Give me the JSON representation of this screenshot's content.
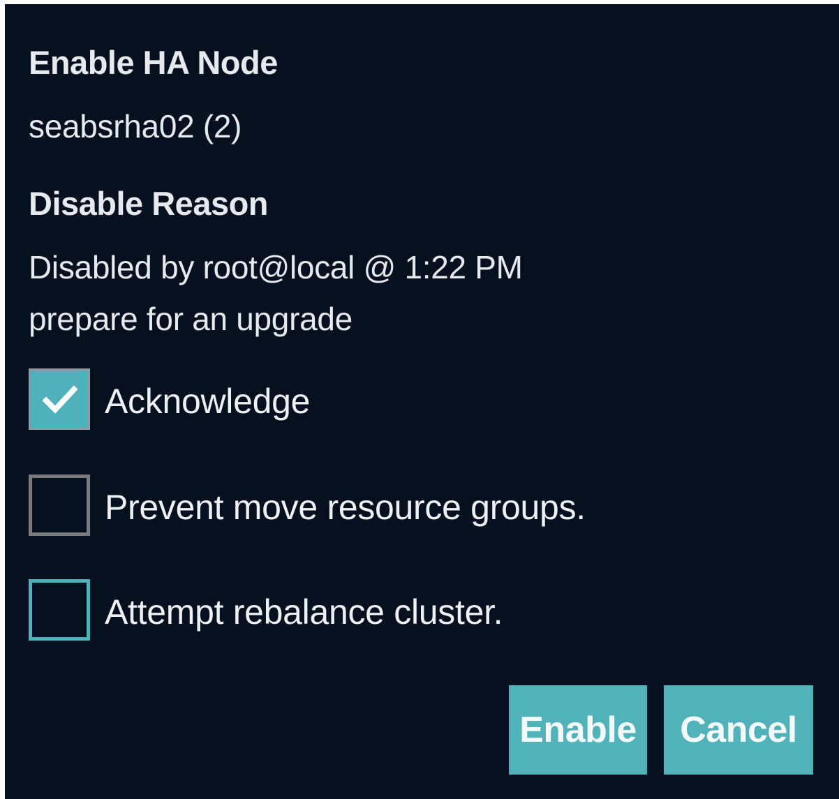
{
  "dialog": {
    "title": "Enable HA Node",
    "node_name": "seabsrha02 (2)",
    "reason_heading": "Disable Reason",
    "reason_line1": "Disabled by  root@local @ 1:22 PM",
    "reason_line2": "prepare for an upgrade"
  },
  "options": {
    "acknowledge": {
      "label": "Acknowledge",
      "checked": true
    },
    "prevent_move": {
      "label": "Prevent move resource groups.",
      "checked": false
    },
    "rebalance": {
      "label": "Attempt rebalance cluster.",
      "checked": false
    }
  },
  "buttons": {
    "enable_label": "Enable",
    "cancel_label": "Cancel"
  },
  "colors": {
    "background": "#06101f",
    "accent": "#4fb1b9",
    "text": "#e6eaee",
    "checkbox_border": "#7a7b7d"
  },
  "icons": {
    "check": "checkmark-icon"
  }
}
